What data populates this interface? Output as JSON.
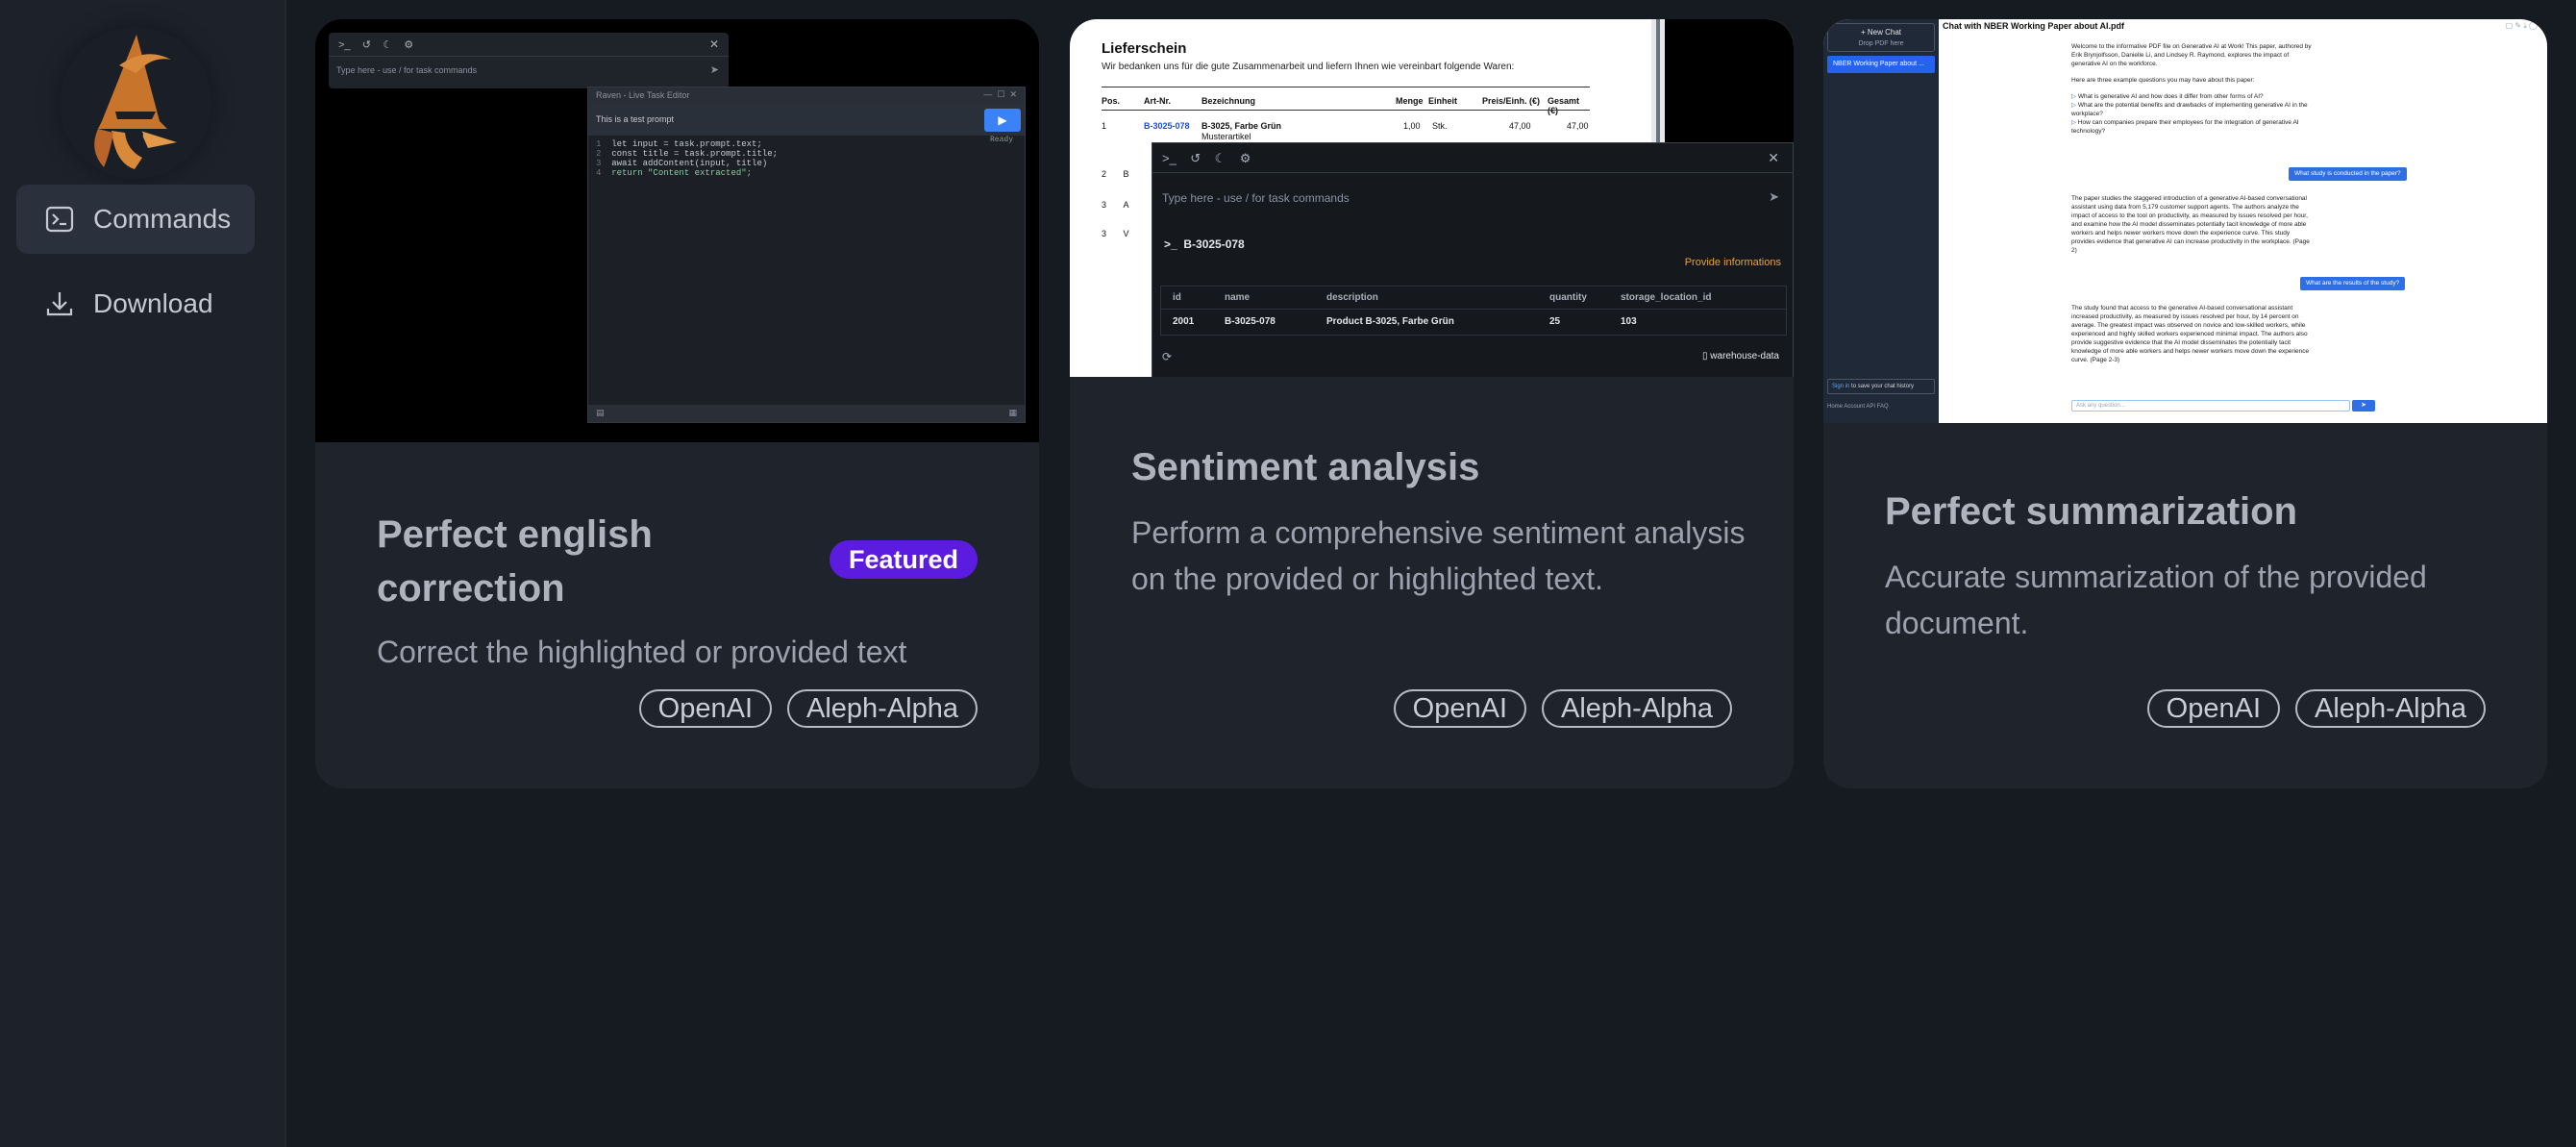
{
  "sidebar": {
    "logo_alt": "wizard bird logo",
    "items": [
      {
        "label": "Commands",
        "icon": "terminal-icon",
        "active": true
      },
      {
        "label": "Download",
        "icon": "download-icon",
        "active": false
      }
    ]
  },
  "cards": [
    {
      "title": "Perfect english correction",
      "badge": "Featured",
      "description": "Correct the highlighted or provided text",
      "tags": [
        "OpenAI",
        "Aleph-Alpha"
      ],
      "preview": {
        "prompt_placeholder": "Type here - use / for task commands",
        "editor_title": "Raven - Live Task Editor",
        "editor_input": "This is a test prompt",
        "code_lines": [
          "let input = task.prompt.text;",
          "const title = task.prompt.title;",
          "await addContent(input, title)",
          "return \"Content extracted\";"
        ],
        "code_hint": "Ready"
      }
    },
    {
      "title": "Sentiment analysis",
      "description": "Perform a comprehensive sentiment analysis on the provided or highlighted text.",
      "tags": [
        "OpenAI",
        "Aleph-Alpha"
      ],
      "preview": {
        "doc_title": "Lieferschein",
        "doc_subtitle": "Wir bedanken uns für die gute Zusammenarbeit und liefern Ihnen wie vereinbart folgende Waren:",
        "doc_headers": [
          "Pos.",
          "Art-Nr.",
          "Bezeichnung",
          "Menge",
          "Einheit",
          "Preis/Einh. (€)",
          "Gesamt (€)"
        ],
        "doc_row": [
          "1",
          "B-3025-078",
          "B-3025, Farbe Grün",
          "1,00",
          "Stk.",
          "47,00",
          "47,00"
        ],
        "doc_row_sub": "Musterartikel",
        "doc_more_pos": [
          "2",
          "3",
          "3"
        ],
        "doc_more_prefix": [
          "B",
          "A",
          "V"
        ],
        "prompt_placeholder": "Type here - use / for task commands",
        "command": "B-3025-078",
        "provide_info": "Provide informations",
        "table_headers": [
          "id",
          "name",
          "description",
          "quantity",
          "storage_location_id"
        ],
        "table_row": [
          "2001",
          "B-3025-078",
          "Product B-3025, Farbe Grün",
          "25",
          "103"
        ],
        "source": "warehouse-data"
      }
    },
    {
      "title": "Perfect summarization",
      "description": "Accurate summarization of the provided document.",
      "tags": [
        "OpenAI",
        "Aleph-Alpha"
      ],
      "preview": {
        "new_chat": "+ New Chat",
        "drop_pdf": "Drop PDF here",
        "chat_item": "NBER Working Paper about ...",
        "chat_title": "Chat with NBER Working Paper about AI.pdf",
        "intro": "Welcome to the informative PDF file on Generative AI at Work! This paper, authored by Erik Brynjolfsson, Danielle Li, and Lindsey R. Raymond, explores the impact of generative AI on the workforce.",
        "examples_head": "Here are three example questions you may have about this paper:",
        "examples": [
          "What is generative AI and how does it differ from other forms of AI?",
          "What are the potential benefits and drawbacks of implementing generative AI in the workplace?",
          "How can companies prepare their employees for the integration of generative AI technology?"
        ],
        "q1": "What study is conducted in the paper?",
        "a1": "The paper studies the staggered introduction of a generative AI-based conversational assistant using data from 5,179 customer support agents. The authors analyze the impact of access to the tool on productivity, as measured by issues resolved per hour, and examine how the AI model disseminates potentially tacit knowledge of more able workers and helps newer workers move down the experience curve. This study provides evidence that generative AI can increase productivity in the workplace. (Page 2)",
        "q2": "What are the results of the study?",
        "a2": "The study found that access to the generative AI-based conversational assistant increased productivity, as measured by issues resolved per hour, by 14 percent on average. The greatest impact was observed on novice and low-skilled workers, while experienced and highly skilled workers experienced minimal impact. The authors also provide suggestive evidence that the AI model disseminates the potentially tacit knowledge of more able workers and helps newer workers move down the experience curve. (Page 2-3)",
        "sign_in": "Sign in",
        "sign_in_suffix": "to save your chat history",
        "footer": "Home   Account   API   FAQ",
        "input_placeholder": "Ask any question...",
        "send": "➤"
      }
    }
  ],
  "colors": {
    "background": "#161a21",
    "sidebar": "#1d212a",
    "card": "#1e232c",
    "badge": "#5b1ce0",
    "accent_blue": "#2f6fe6"
  }
}
